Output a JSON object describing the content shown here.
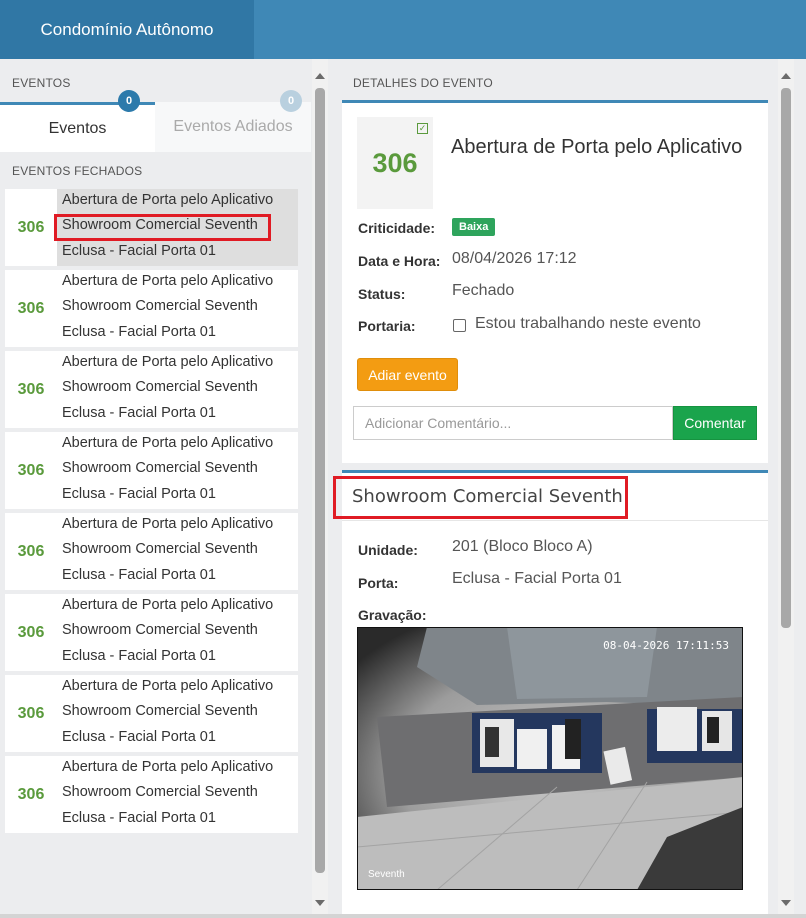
{
  "app": {
    "title": "Condomínio Autônomo"
  },
  "left": {
    "section_label": "EVENTOS",
    "tabs": [
      {
        "label": "Eventos",
        "count": "0"
      },
      {
        "label": "Eventos Adiados",
        "count": "0"
      }
    ],
    "closed_label": "EVENTOS FECHADOS",
    "events": [
      {
        "number": "306",
        "line1": "Abertura de Porta pelo Aplicativo",
        "line2": "Showroom Comercial Seventh",
        "line3": "Eclusa - Facial Porta 01"
      },
      {
        "number": "306",
        "line1": "Abertura de Porta pelo Aplicativo",
        "line2": "Showroom Comercial Seventh",
        "line3": "Eclusa - Facial Porta 01"
      },
      {
        "number": "306",
        "line1": "Abertura de Porta pelo Aplicativo",
        "line2": "Showroom Comercial Seventh",
        "line3": "Eclusa - Facial Porta 01"
      },
      {
        "number": "306",
        "line1": "Abertura de Porta pelo Aplicativo",
        "line2": "Showroom Comercial Seventh",
        "line3": "Eclusa - Facial Porta 01"
      },
      {
        "number": "306",
        "line1": "Abertura de Porta pelo Aplicativo",
        "line2": "Showroom Comercial Seventh",
        "line3": "Eclusa - Facial Porta 01"
      },
      {
        "number": "306",
        "line1": "Abertura de Porta pelo Aplicativo",
        "line2": "Showroom Comercial Seventh",
        "line3": "Eclusa - Facial Porta 01"
      },
      {
        "number": "306",
        "line1": "Abertura de Porta pelo Aplicativo",
        "line2": "Showroom Comercial Seventh",
        "line3": "Eclusa - Facial Porta 01"
      },
      {
        "number": "306",
        "line1": "Abertura de Porta pelo Aplicativo",
        "line2": "Showroom Comercial Seventh",
        "line3": "Eclusa - Facial Porta 01"
      }
    ]
  },
  "details": {
    "section_label": "DETALHES DO EVENTO",
    "number": "306",
    "title": "Abertura de Porta pelo Aplicativo",
    "criticidade_label": "Criticidade:",
    "criticidade_value": "Baixa",
    "datahora_label": "Data e Hora:",
    "datahora_value": "08/04/2026 17:12",
    "status_label": "Status:",
    "status_value": "Fechado",
    "portaria_label": "Portaria:",
    "portaria_checkbox_label": "Estou trabalhando neste evento",
    "adiar_button": "Adiar evento",
    "comment_placeholder": "Adicionar Comentário...",
    "comentar_button": "Comentar"
  },
  "location": {
    "title": "Showroom Comercial Seventh",
    "unidade_label": "Unidade:",
    "unidade_value": "201 (Bloco Bloco A)",
    "porta_label": "Porta:",
    "porta_value": "Eclusa - Facial Porta 01",
    "gravacao_label": "Gravação:",
    "video_timestamp": "08-04-2026 17:11:53",
    "video_watermark": "Seventh"
  },
  "colors": {
    "brand": "#3f88b6",
    "number_green": "#5a9a3c",
    "badge_green": "#2ea45c",
    "adiar_orange": "#f39c12",
    "comentar_green": "#1aa44c",
    "highlight_red": "#e01b24"
  }
}
